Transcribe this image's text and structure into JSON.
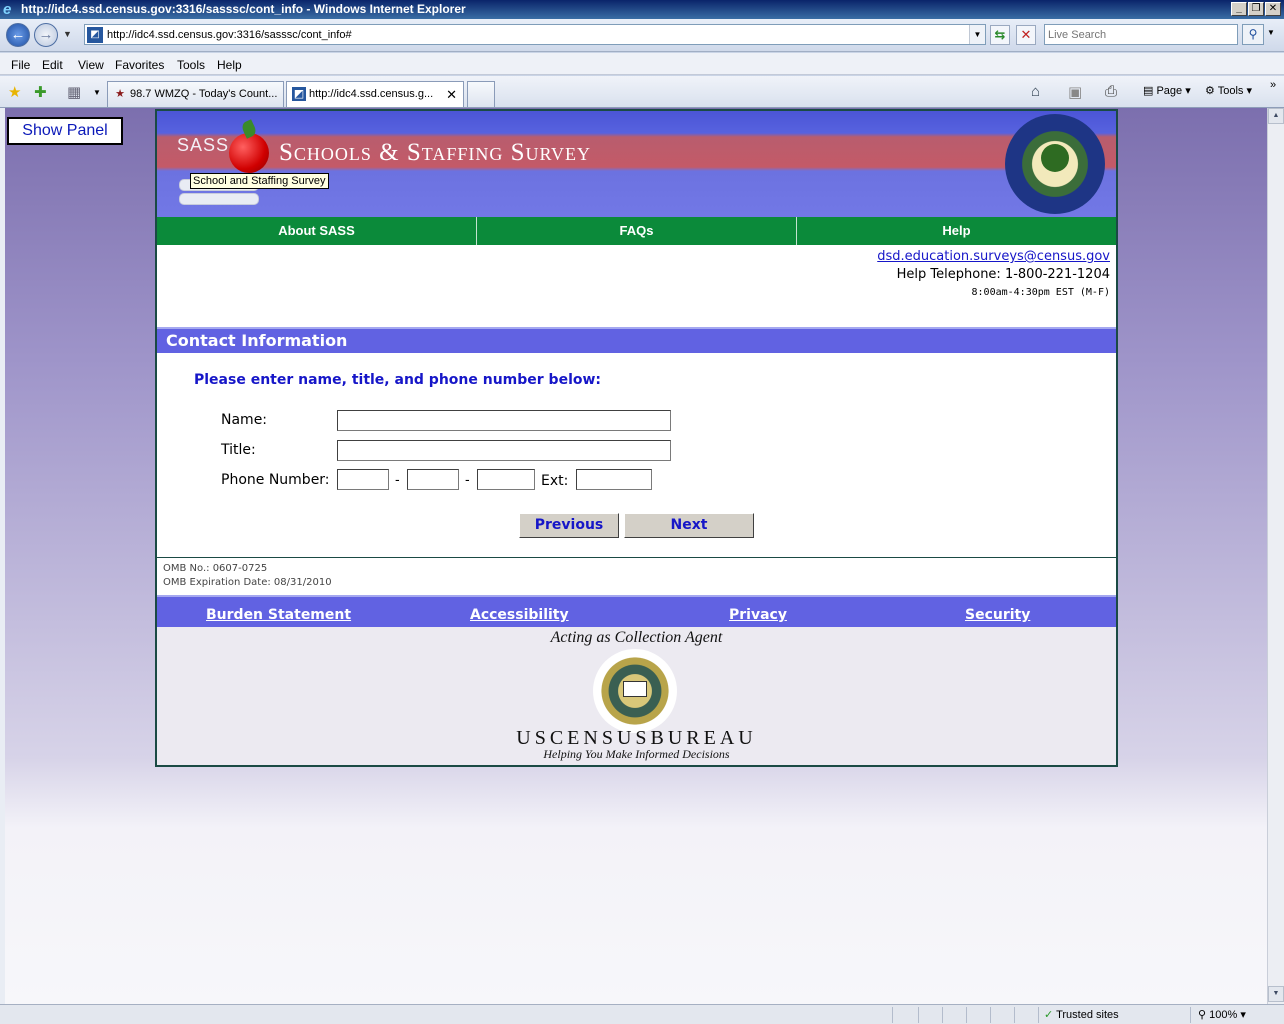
{
  "window": {
    "title": "http://idc4.ssd.census.gov:3316/sasssc/cont_info - Windows Internet Explorer",
    "url": "http://idc4.ssd.census.gov:3316/sasssc/cont_info#",
    "search_placeholder": "Live Search"
  },
  "menu": [
    "File",
    "Edit",
    "View",
    "Favorites",
    "Tools",
    "Help"
  ],
  "tabs": [
    {
      "label": "98.7 WMZQ - Today's Count..."
    },
    {
      "label": "http://idc4.ssd.census.g..."
    }
  ],
  "commands": {
    "page": "Page",
    "tools": "Tools"
  },
  "show_panel": "Show Panel",
  "banner": {
    "sass": "SASS",
    "title": "Schools & Staffing Survey",
    "tooltip": "School and Staffing Survey",
    "seal_text": "DEPARTMENT OF EDUCATION"
  },
  "topnav": [
    "About SASS",
    "FAQs",
    "Help"
  ],
  "help": {
    "email": "dsd.education.surveys@census.gov",
    "phone": "Help Telephone: 1-800-221-1204",
    "hours": "8:00am-4:30pm EST (M-F)"
  },
  "section_title": "Contact Information",
  "form": {
    "instructions": "Please enter name, title, and phone number below:",
    "name_label": "Name:",
    "title_label": "Title:",
    "phone_label": "Phone Number:",
    "ext_label": "Ext:",
    "dash": "-",
    "name_value": "",
    "title_value": "",
    "phone_area": "",
    "phone_prefix": "",
    "phone_line": "",
    "phone_ext": "",
    "previous_label": "Previous",
    "next_label": "Next"
  },
  "omb": {
    "number": "OMB No.: 0607-0725",
    "expiration": "OMB Expiration Date: 08/31/2010"
  },
  "footer_links": [
    "Burden Statement",
    "Accessibility",
    "Privacy",
    "Security"
  ],
  "agent": {
    "text": "Acting as Collection Agent",
    "census_name": "USCENSUSBUREAU",
    "tagline": "Helping You Make Informed Decisions"
  },
  "status": {
    "zone": "Trusted sites",
    "zoom": "100%"
  },
  "colors": {
    "nav_green": "#0b8a3a",
    "section_blue": "#6162e2",
    "link_blue": "#1616c8"
  }
}
